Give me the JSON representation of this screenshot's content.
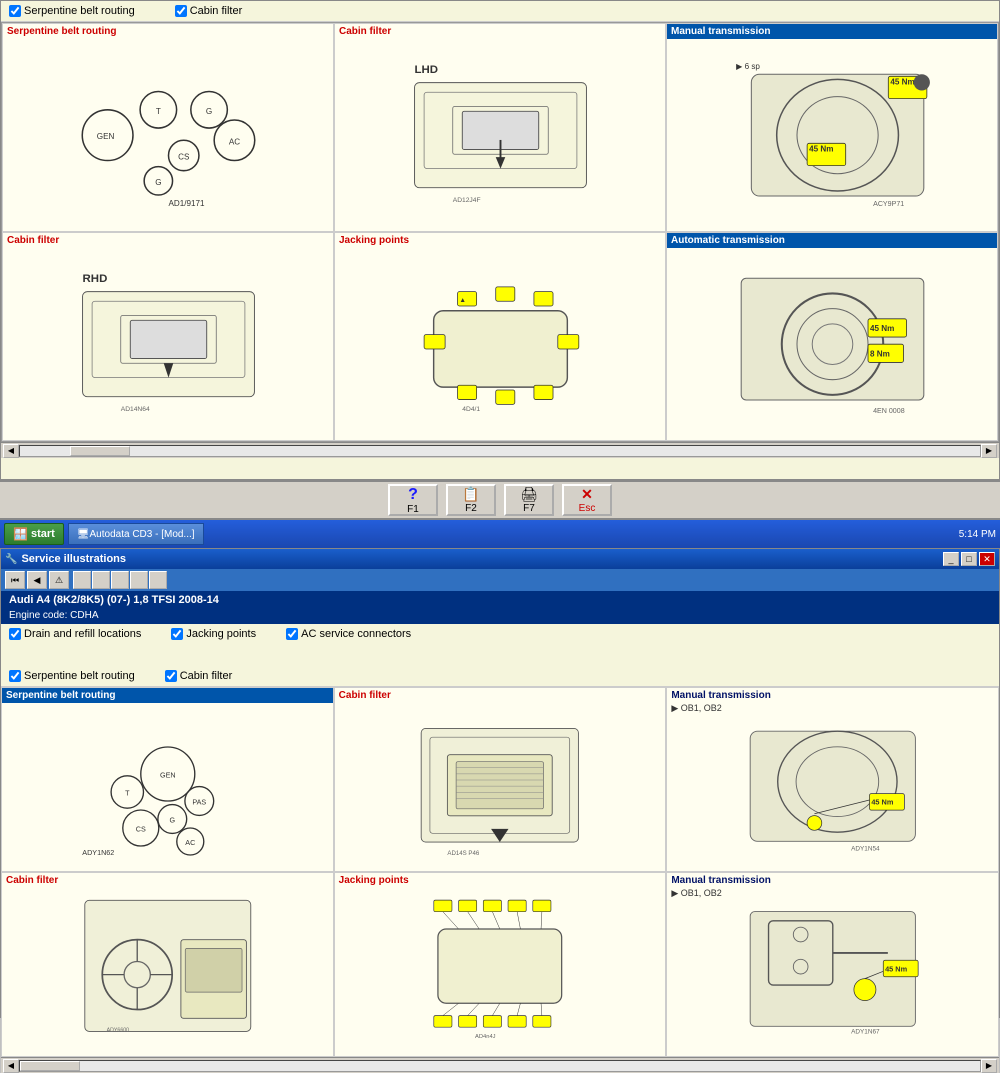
{
  "top_window": {
    "checkboxes": [
      {
        "id": "cb1",
        "label": "Serpentine belt routing",
        "checked": true
      },
      {
        "id": "cb2",
        "label": "Cabin filter",
        "checked": true
      }
    ],
    "cells": [
      {
        "title": "Serpentine belt routing",
        "title_color": "red",
        "id": "cell-serpentine-1"
      },
      {
        "title": "Cabin filter",
        "title_color": "red",
        "subtitle": "LHD",
        "id": "cell-cabin-lhd"
      },
      {
        "title": "Manual transmission",
        "title_color": "blue",
        "id": "cell-manual-trans-1"
      },
      {
        "title": "Cabin filter",
        "title_color": "red",
        "subtitle": "RHD",
        "id": "cell-cabin-rhd"
      },
      {
        "title": "Jacking points",
        "title_color": "red",
        "id": "cell-jacking-1"
      },
      {
        "title": "Automatic transmission",
        "title_color": "blue",
        "id": "cell-auto-trans"
      }
    ]
  },
  "toolbar": {
    "buttons": [
      {
        "label": "F1",
        "icon": "?",
        "id": "btn-f1"
      },
      {
        "label": "F2",
        "icon": "📋",
        "id": "btn-f2"
      },
      {
        "label": "F7",
        "icon": "🖨",
        "id": "btn-f7"
      },
      {
        "label": "Esc",
        "icon": "✕",
        "id": "btn-esc"
      }
    ]
  },
  "taskbar": {
    "start_label": "start",
    "items": [
      {
        "label": "Autodata CD3 - [Mod...]",
        "id": "taskbar-autodata"
      }
    ],
    "time": "5:14 PM"
  },
  "bottom_app": {
    "title": "Service illustrations",
    "vehicle_info": "Audi  A4 (8K2/8K5) (07-) 1,8 TFSI 2008-14",
    "engine_code": "Engine code: CDHA",
    "checkboxes": [
      {
        "id": "bc1",
        "label": "Drain and refill locations",
        "checked": true
      },
      {
        "id": "bc2",
        "label": "Serpentine belt routing",
        "checked": true
      },
      {
        "id": "bc3",
        "label": "Jacking points",
        "checked": true
      },
      {
        "id": "bc4",
        "label": "Cabin filter",
        "checked": true
      },
      {
        "id": "bc5",
        "label": "AC service connectors",
        "checked": true
      }
    ],
    "cells": [
      {
        "title": "Serpentine belt routing",
        "title_color": "blue-bg",
        "id": "bcell-serpentine"
      },
      {
        "title": "Cabin filter",
        "title_color": "red",
        "id": "bcell-cabin-1"
      },
      {
        "title": "Manual transmission",
        "title_color": "dark",
        "subtitle": "OB1, OB2",
        "id": "bcell-manual-1"
      },
      {
        "title": "Cabin filter",
        "title_color": "red",
        "id": "bcell-cabin-2"
      },
      {
        "title": "Jacking points",
        "title_color": "red",
        "id": "bcell-jacking"
      },
      {
        "title": "Manual transmission",
        "title_color": "dark",
        "subtitle": "OB1, OB2",
        "id": "bcell-manual-2"
      }
    ]
  }
}
